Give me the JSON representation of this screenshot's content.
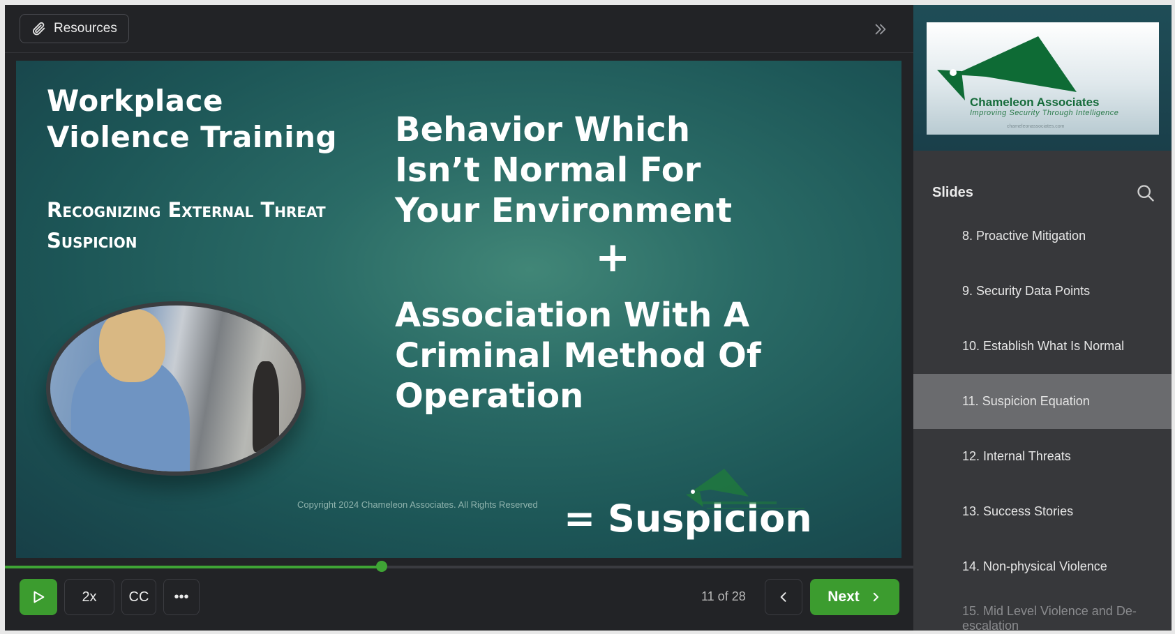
{
  "toolbar": {
    "resources_label": "Resources"
  },
  "slide": {
    "title": "Workplace Violence Training",
    "subtitle": "Recognizing External Threat Suspicion",
    "behavior_text": "Behavior Which Isn’t Normal For Your Environment",
    "plus": "+",
    "association_text": "Association With A Criminal Method Of Operation",
    "equals": "=",
    "result": "Suspicion",
    "copyright": "Copyright 2024 Chameleon Associates. All Rights Reserved"
  },
  "player": {
    "progress": 0.415,
    "speed_label": "2x",
    "cc_label": "CC",
    "more_label": "•••",
    "counter": "11 of 28",
    "next_label": "Next"
  },
  "sidebar": {
    "logo": {
      "brand": "Chameleon Associates",
      "tagline": "Improving Security Through Intelligence",
      "url": "chameleonassociates.com"
    },
    "heading": "Slides",
    "items": [
      {
        "label": "8. Proactive Mitigation"
      },
      {
        "label": "9. Security Data Points"
      },
      {
        "label": "10. Establish What Is Normal"
      },
      {
        "label": "11. Suspicion Equation"
      },
      {
        "label": "12. Internal Threats"
      },
      {
        "label": "13. Success Stories"
      },
      {
        "label": "14. Non-physical Violence"
      },
      {
        "label": "15. Mid Level Violence and De-escalation"
      }
    ]
  },
  "colors": {
    "accent_green": "#3c9c2f",
    "active_item": "#6a6b6e",
    "background": "#222326"
  }
}
